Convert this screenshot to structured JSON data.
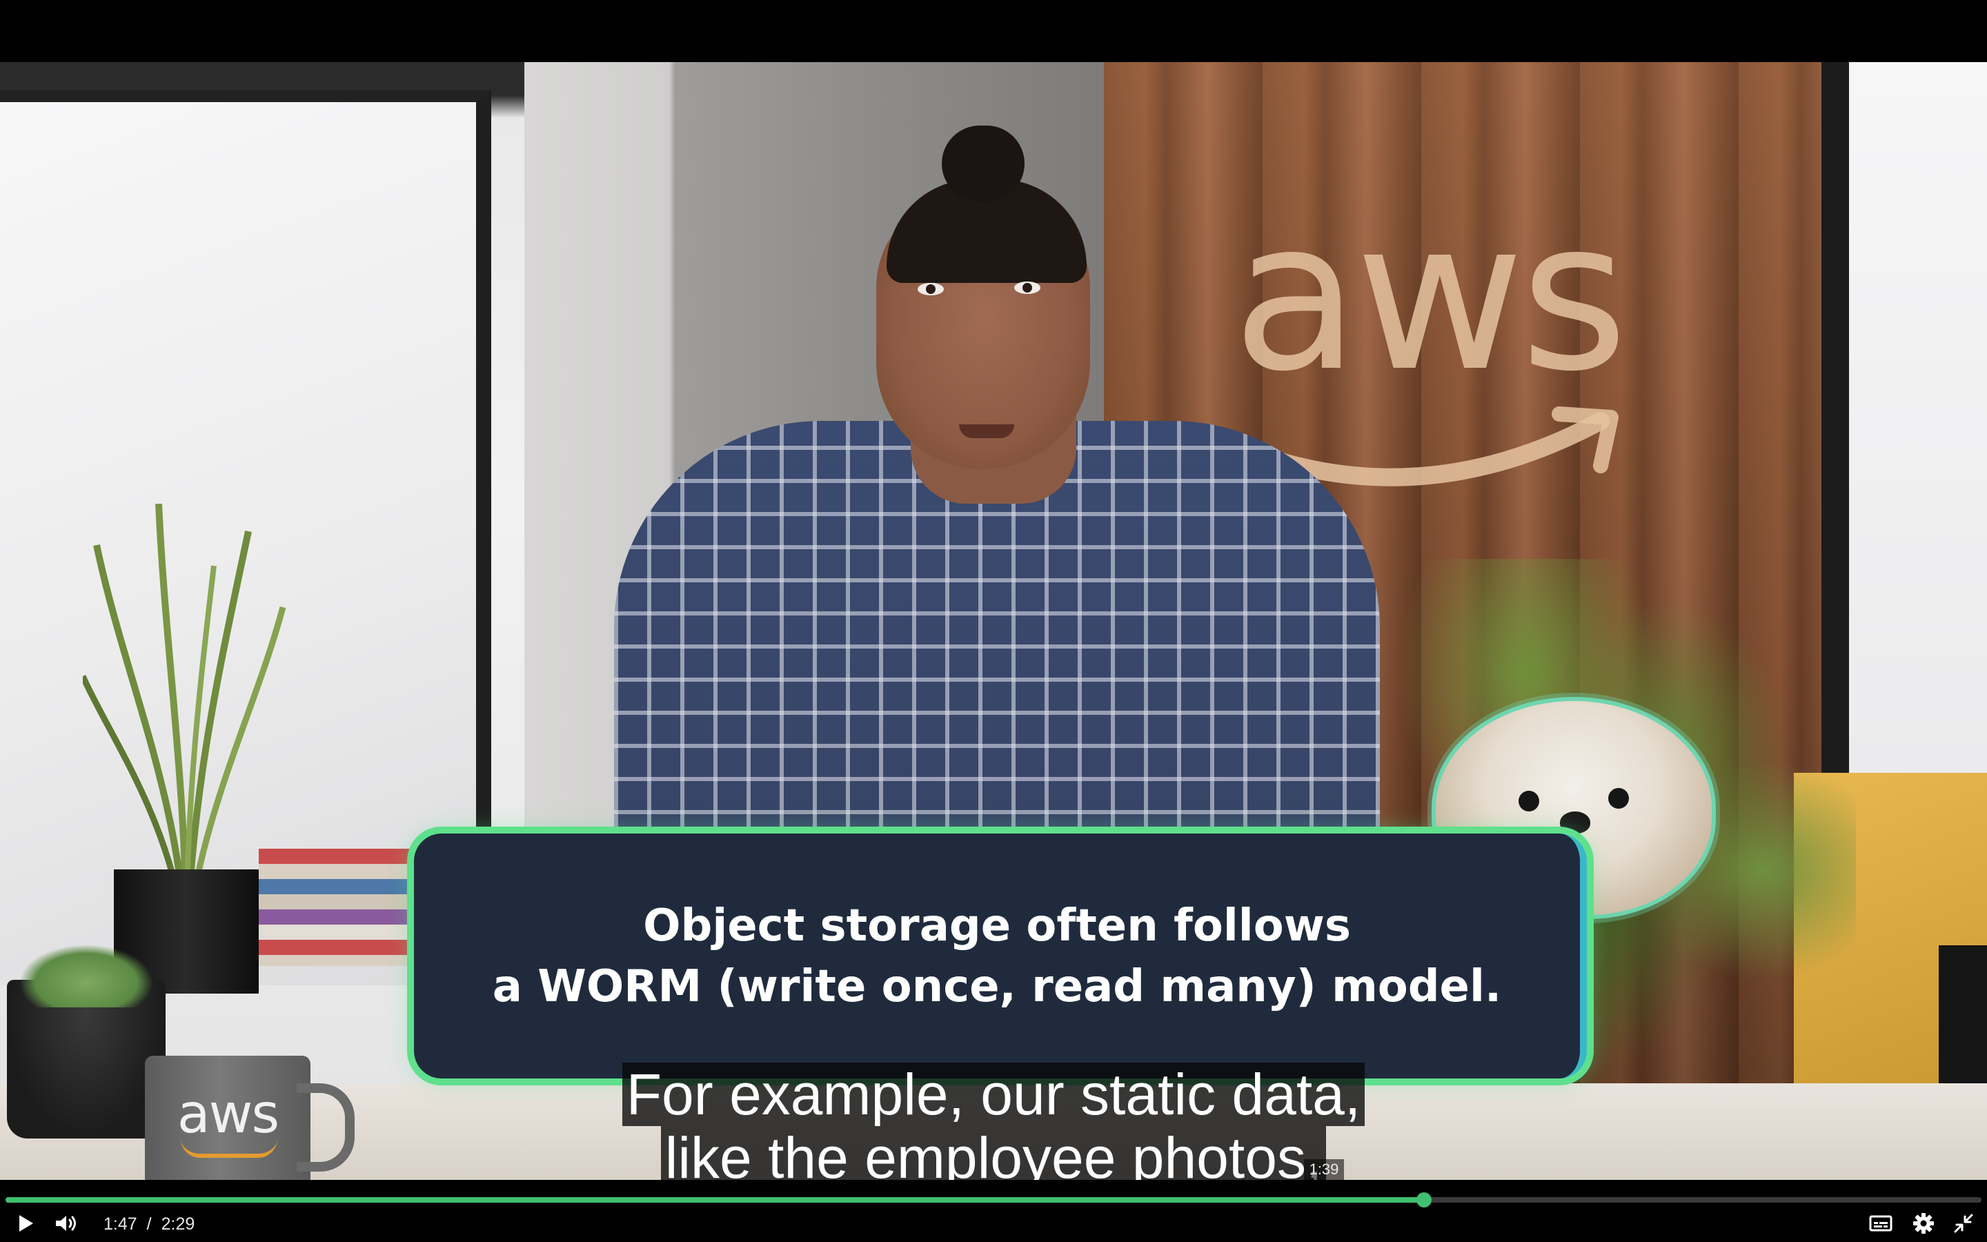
{
  "video": {
    "wall_logo_text": "aws",
    "mug_logo_text": "aws",
    "callout": {
      "line1": "Object storage often follows",
      "line2": "a WORM (write once, read many) model."
    }
  },
  "captions": {
    "line1": "For example, our static data,",
    "line2": "like the employee photos,"
  },
  "player": {
    "current_time": "1:47",
    "separator": "/",
    "duration": "2:29",
    "hover_time": "1:39",
    "progress_fraction": 0.718,
    "accent_color": "#3fbf6f",
    "icons": {
      "play": "play-icon",
      "volume": "volume-icon",
      "captions": "captions-icon",
      "settings": "gear-icon",
      "exit_fullscreen": "exit-fullscreen-icon"
    }
  }
}
